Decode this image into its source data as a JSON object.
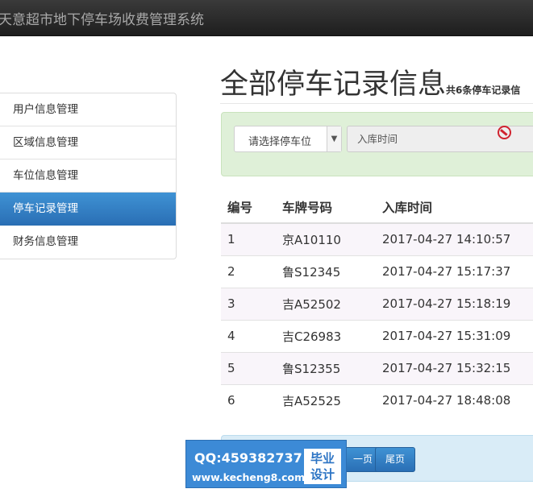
{
  "navbar": {
    "brand": "天意超市地下停车场收费管理系统"
  },
  "sidebar": {
    "items": [
      {
        "label": "用户信息管理"
      },
      {
        "label": "区域信息管理"
      },
      {
        "label": "车位信息管理"
      },
      {
        "label": "停车记录管理"
      },
      {
        "label": "财务信息管理"
      }
    ],
    "active_index": 3
  },
  "main": {
    "title": "全部停车记录信息",
    "count_text": "共6条停车记录信"
  },
  "filter": {
    "select_value": "请选择停车位",
    "date_label": "入库时间",
    "date_value": ""
  },
  "table": {
    "headers": [
      "编号",
      "车牌号码",
      "入库时间"
    ],
    "rows": [
      [
        "1",
        "京A10110",
        "2017-04-27 14:10:57"
      ],
      [
        "2",
        "鲁S12345",
        "2017-04-27 15:17:37"
      ],
      [
        "3",
        "吉A52502",
        "2017-04-27 15:18:19"
      ],
      [
        "4",
        "吉C26983",
        "2017-04-27 15:31:09"
      ],
      [
        "5",
        "鲁S12355",
        "2017-04-27 15:32:15"
      ],
      [
        "6",
        "吉A52525",
        "2017-04-27 18:48:08"
      ]
    ]
  },
  "pagination": {
    "prev_partial": "一页",
    "last": "尾页"
  },
  "watermark": {
    "qq": "QQ:459382737",
    "site": "www.kecheng8.com",
    "badge_line1": "毕业",
    "badge_line2": "设计"
  },
  "colors": {
    "accent": "#2a78c2",
    "filter_bg": "#dff0d8",
    "pager_bg": "#d9ecf7",
    "navbar_bg": "#2b2b2b"
  }
}
